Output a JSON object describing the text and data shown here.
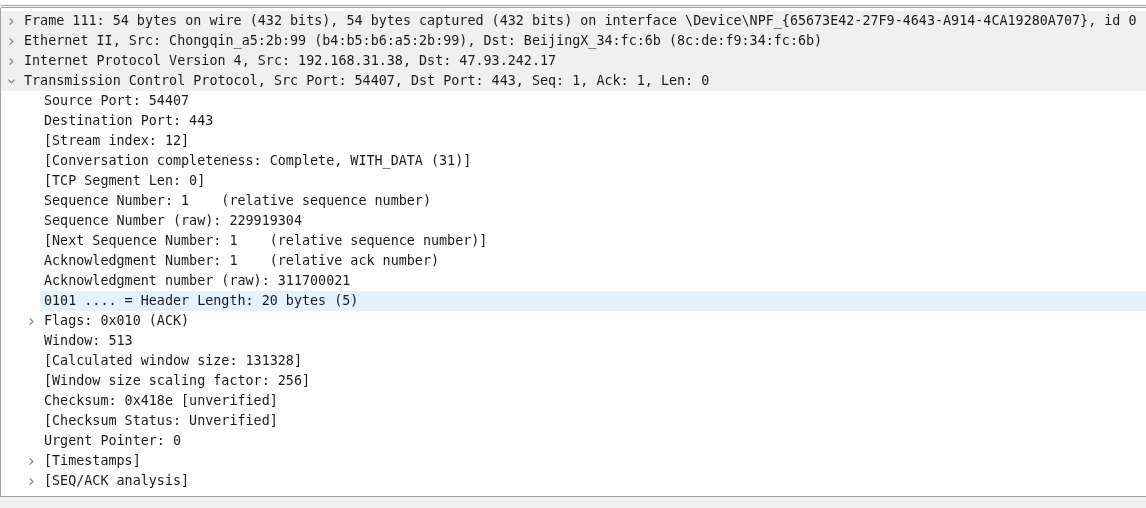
{
  "packet_details": {
    "items": [
      {
        "text": "Frame 111: 54 bytes on wire (432 bits), 54 bytes captured (432 bits) on interface \\Device\\NPF_{65673E42-27F9-4643-A914-4CA19280A707}, id 0",
        "expanded": false,
        "selected": false
      },
      {
        "text": "Ethernet II, Src: Chongqin_a5:2b:99 (b4:b5:b6:a5:2b:99), Dst: BeijingX_34:fc:6b (8c:de:f9:34:fc:6b)",
        "expanded": false,
        "selected": false
      },
      {
        "text": "Internet Protocol Version 4, Src: 192.168.31.38, Dst: 47.93.242.17",
        "expanded": false,
        "selected": false
      },
      {
        "text": "Transmission Control Protocol, Src Port: 54407, Dst Port: 443, Seq: 1, Ack: 1, Len: 0",
        "expanded": true,
        "selected": false,
        "children": [
          {
            "text": "Source Port: 54407",
            "selected": false
          },
          {
            "text": "Destination Port: 443",
            "selected": false
          },
          {
            "text": "[Stream index: 12]",
            "selected": false
          },
          {
            "text": "[Conversation completeness: Complete, WITH_DATA (31)]",
            "selected": false
          },
          {
            "text": "[TCP Segment Len: 0]",
            "selected": false
          },
          {
            "text": "Sequence Number: 1    (relative sequence number)",
            "selected": false
          },
          {
            "text": "Sequence Number (raw): 229919304",
            "selected": false
          },
          {
            "text": "[Next Sequence Number: 1    (relative sequence number)]",
            "selected": false
          },
          {
            "text": "Acknowledgment Number: 1    (relative ack number)",
            "selected": false
          },
          {
            "text": "Acknowledgment number (raw): 311700021",
            "selected": false
          },
          {
            "text": "0101 .... = Header Length: 20 bytes (5)",
            "selected": true
          },
          {
            "text": "Flags: 0x010 (ACK)",
            "expanded": false,
            "selected": false
          },
          {
            "text": "Window: 513",
            "selected": false
          },
          {
            "text": "[Calculated window size: 131328]",
            "selected": false
          },
          {
            "text": "[Window size scaling factor: 256]",
            "selected": false
          },
          {
            "text": "Checksum: 0x418e [unverified]",
            "selected": false
          },
          {
            "text": "[Checksum Status: Unverified]",
            "selected": false
          },
          {
            "text": "Urgent Pointer: 0",
            "selected": false
          },
          {
            "text": "[Timestamps]",
            "expanded": false,
            "selected": false
          },
          {
            "text": "[SEQ/ACK analysis]",
            "expanded": false,
            "selected": false
          }
        ]
      }
    ]
  }
}
